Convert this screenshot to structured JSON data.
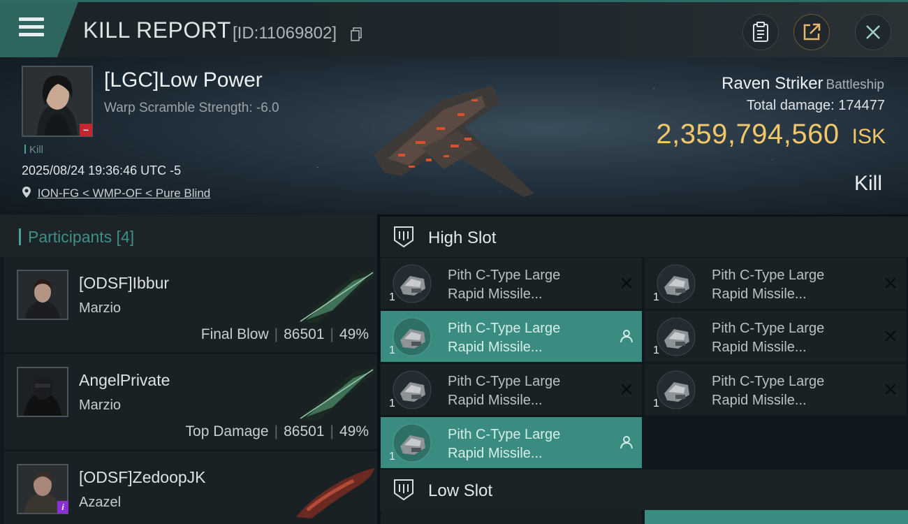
{
  "header": {
    "title": "KILL REPORT",
    "report_id": "[ID:11069802]"
  },
  "victim": {
    "name": "[LGC]Low Power",
    "warp_scramble": "Warp Scramble Strength: -6.0",
    "tag": "Kill",
    "datetime": "2025/08/24 19:36:46 UTC -5",
    "location": "ION-FG < WMP-OF < Pure Blind",
    "ship_name": "Raven Striker",
    "ship_class": "Battleship",
    "total_damage_label": "Total damage:",
    "total_damage": "174477",
    "isk_value": "2,359,794,560",
    "isk_unit": "ISK",
    "outcome": "Kill"
  },
  "participants": {
    "title": "Participants [4]",
    "rows": [
      {
        "name": "[ODSF]Ibbur",
        "ship": "Marzio",
        "role": "Final Blow",
        "damage": "86501",
        "percent": "49%"
      },
      {
        "name": "AngelPrivate",
        "ship": "Marzio",
        "role": "Top Damage",
        "damage": "86501",
        "percent": "49%"
      },
      {
        "name": "[ODSF]ZedoopJK",
        "ship": "Azazel",
        "role": "",
        "damage": "",
        "percent": ""
      }
    ]
  },
  "slots": {
    "high_slot_label": "High Slot",
    "low_slot_label": "Low Slot",
    "high_modules": [
      {
        "line1": "Pith C-Type Large",
        "line2": "Rapid Missile...",
        "qty": "1",
        "status": "destroyed"
      },
      {
        "line1": "Pith C-Type Large",
        "line2": "Rapid Missile...",
        "qty": "1",
        "status": "destroyed"
      },
      {
        "line1": "Pith C-Type Large",
        "line2": "Rapid Missile...",
        "qty": "1",
        "status": "dropped"
      },
      {
        "line1": "Pith C-Type Large",
        "line2": "Rapid Missile...",
        "qty": "1",
        "status": "destroyed"
      },
      {
        "line1": "Pith C-Type Large",
        "line2": "Rapid Missile...",
        "qty": "1",
        "status": "destroyed"
      },
      {
        "line1": "Pith C-Type Large",
        "line2": "Rapid Missile...",
        "qty": "1",
        "status": "destroyed"
      },
      {
        "line1": "Pith C-Type Large",
        "line2": "Rapid Missile...",
        "qty": "1",
        "status": "dropped"
      }
    ]
  },
  "colors": {
    "accent_teal": "#3a8c80",
    "isk_gold": "#f2c76a",
    "victim_badge_red": "#c52730",
    "info_badge_purple": "#8a2fd1"
  },
  "icons": [
    "menu-icon",
    "copy-icon",
    "clipboard-icon",
    "share-icon",
    "close-icon",
    "location-pin-icon",
    "high-slot-icon",
    "low-slot-icon",
    "module-icon",
    "destroyed-icon",
    "dropped-icon"
  ]
}
